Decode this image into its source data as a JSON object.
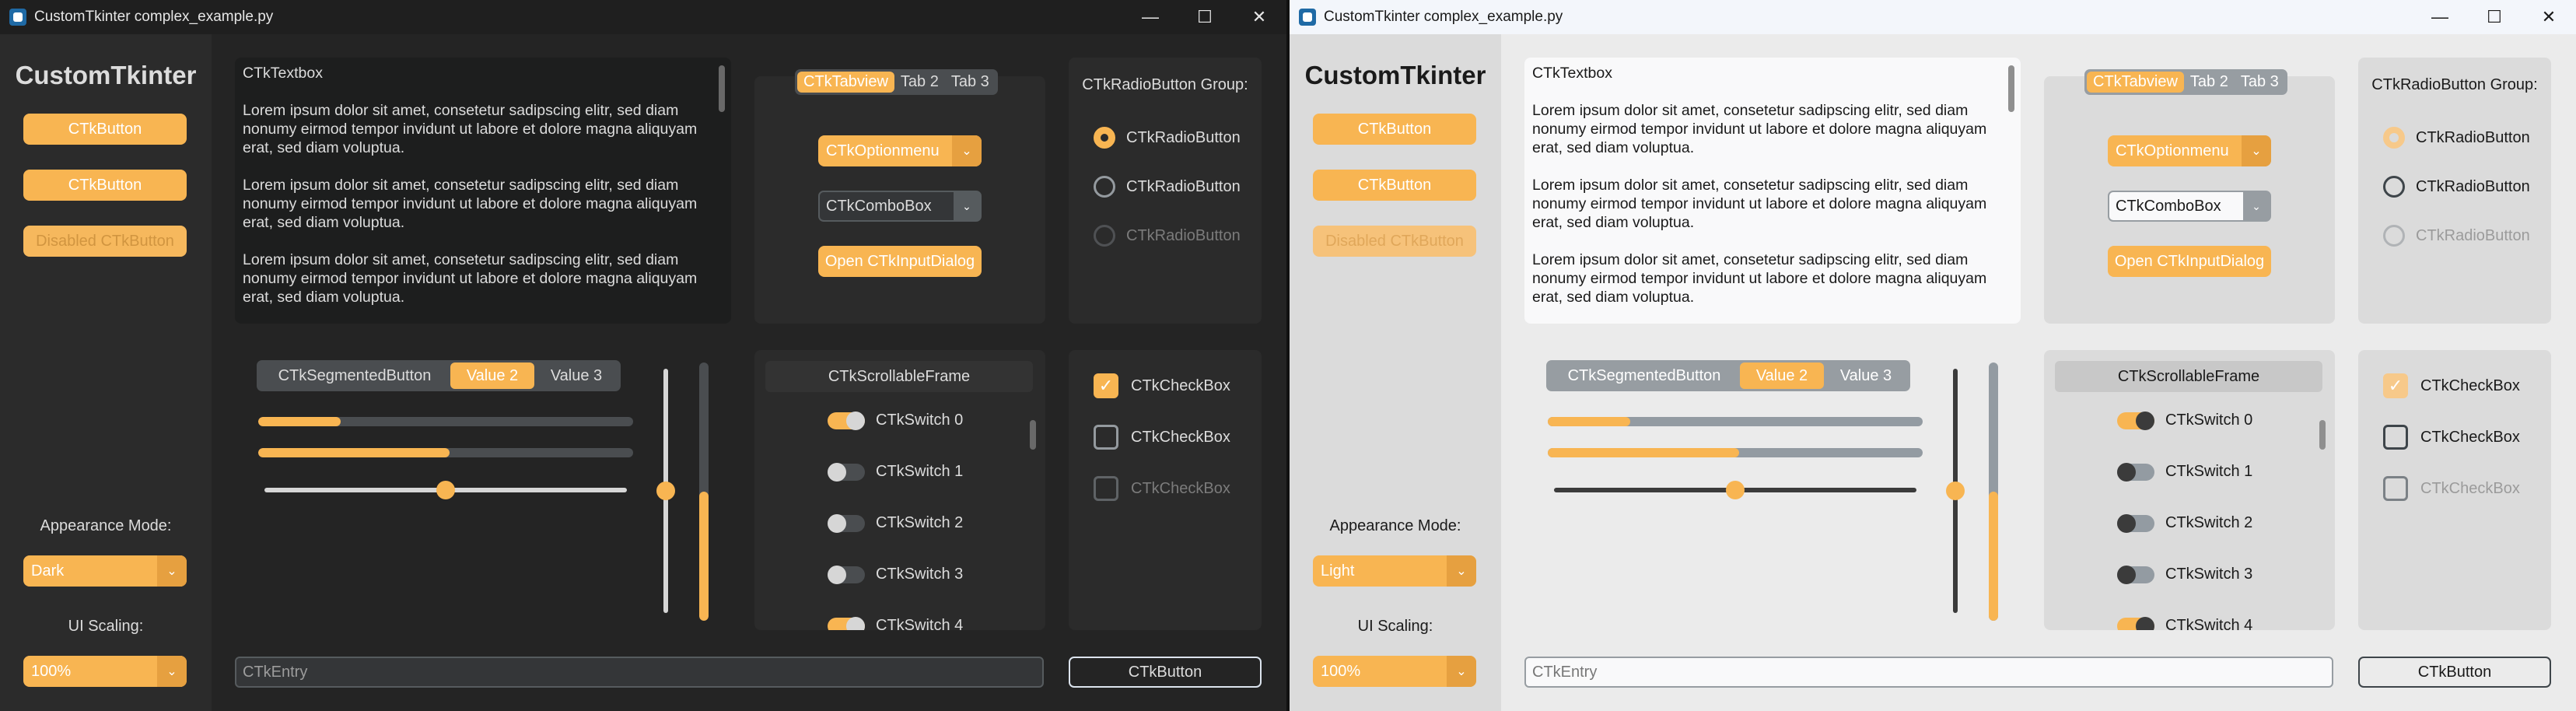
{
  "windows": [
    {
      "theme": "dark",
      "title": "CustomTkinter complex_example.py",
      "logo": "CustomTkinter",
      "sidebar_buttons": [
        "CTkButton",
        "CTkButton",
        "Disabled CTkButton"
      ],
      "appearance_label": "Appearance Mode:",
      "appearance_value": "Dark",
      "scaling_label": "UI Scaling:",
      "scaling_value": "100%",
      "textbox_title": "CTkTextbox",
      "textbox_paragraphs": [
        "Lorem ipsum dolor sit amet, consetetur sadipscing elitr, sed diam nonumy eirmod tempor invidunt ut labore et dolore magna aliquyam erat, sed diam voluptua.",
        "Lorem ipsum dolor sit amet, consetetur sadipscing elitr, sed diam nonumy eirmod tempor invidunt ut labore et dolore magna aliquyam erat, sed diam voluptua.",
        "Lorem ipsum dolor sit amet, consetetur sadipscing elitr, sed diam nonumy eirmod tempor invidunt ut labore et dolore magna aliquyam erat, sed diam voluptua."
      ],
      "tabs": [
        "CTkTabview",
        "Tab 2",
        "Tab 3"
      ],
      "optionmenu_value": "CTkOptionmenu",
      "combobox_value": "CTkComboBox",
      "input_dialog_button": "Open CTkInputDialog",
      "radio_group_label": "CTkRadioButton Group:",
      "radio_buttons": [
        "CTkRadioButton",
        "CTkRadioButton",
        "CTkRadioButton"
      ],
      "segmented": [
        "CTkSegmentedButton",
        "Value 2",
        "Value 3"
      ],
      "progress": [
        0.22,
        0.51
      ],
      "hslider_value": 0.5,
      "vslider_value": 0.5,
      "vprogress_value": 0.5,
      "scrollable_title": "CTkScrollableFrame",
      "switches": [
        "CTkSwitch 0",
        "CTkSwitch 1",
        "CTkSwitch 2",
        "CTkSwitch 3",
        "CTkSwitch 4"
      ],
      "checkboxes": [
        "CTkCheckBox",
        "CTkCheckBox",
        "CTkCheckBox"
      ],
      "entry_placeholder": "CTkEntry",
      "main_button": "CTkButton"
    },
    {
      "theme": "light",
      "title": "CustomTkinter complex_example.py",
      "logo": "CustomTkinter",
      "sidebar_buttons": [
        "CTkButton",
        "CTkButton",
        "Disabled CTkButton"
      ],
      "appearance_label": "Appearance Mode:",
      "appearance_value": "Light",
      "scaling_label": "UI Scaling:",
      "scaling_value": "100%",
      "textbox_title": "CTkTextbox",
      "textbox_paragraphs": [
        "Lorem ipsum dolor sit amet, consetetur sadipscing elitr, sed diam nonumy eirmod tempor invidunt ut labore et dolore magna aliquyam erat, sed diam voluptua.",
        "Lorem ipsum dolor sit amet, consetetur sadipscing elitr, sed diam nonumy eirmod tempor invidunt ut labore et dolore magna aliquyam erat, sed diam voluptua.",
        "Lorem ipsum dolor sit amet, consetetur sadipscing elitr, sed diam nonumy eirmod tempor invidunt ut labore et dolore magna aliquyam erat, sed diam voluptua."
      ],
      "tabs": [
        "CTkTabview",
        "Tab 2",
        "Tab 3"
      ],
      "optionmenu_value": "CTkOptionmenu",
      "combobox_value": "CTkComboBox",
      "input_dialog_button": "Open CTkInputDialog",
      "radio_group_label": "CTkRadioButton Group:",
      "radio_buttons": [
        "CTkRadioButton",
        "CTkRadioButton",
        "CTkRadioButton"
      ],
      "segmented": [
        "CTkSegmentedButton",
        "Value 2",
        "Value 3"
      ],
      "progress": [
        0.22,
        0.51
      ],
      "hslider_value": 0.5,
      "vslider_value": 0.5,
      "vprogress_value": 0.5,
      "scrollable_title": "CTkScrollableFrame",
      "switches": [
        "CTkSwitch 0",
        "CTkSwitch 1",
        "CTkSwitch 2",
        "CTkSwitch 3",
        "CTkSwitch 4"
      ],
      "checkboxes": [
        "CTkCheckBox",
        "CTkCheckBox",
        "CTkCheckBox"
      ],
      "entry_placeholder": "CTkEntry",
      "main_button": "CTkButton"
    }
  ],
  "accent_color": "#f8b552"
}
